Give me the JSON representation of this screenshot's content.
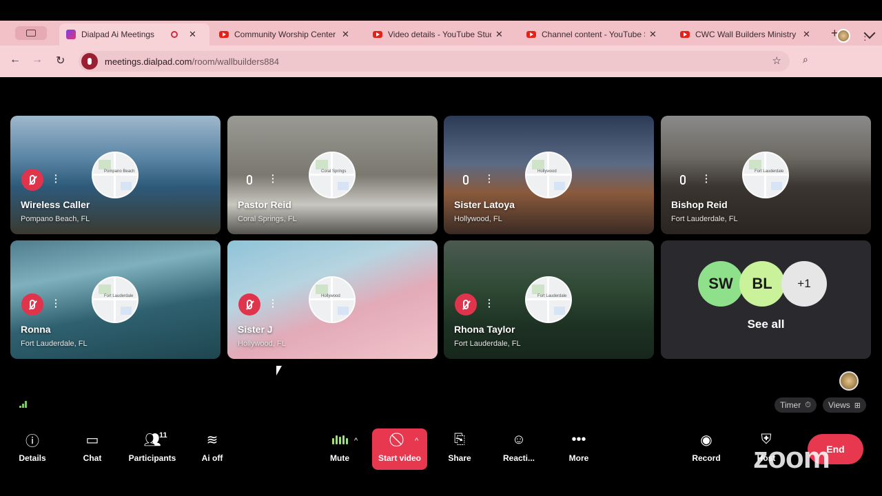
{
  "browser": {
    "tabs": [
      {
        "title": "Dialpad Ai Meetings",
        "kind": "dialpad",
        "active": true
      },
      {
        "title": "Community Worship Center (",
        "kind": "youtube"
      },
      {
        "title": "Video details - YouTube Stud",
        "kind": "youtube"
      },
      {
        "title": "Channel content - YouTube S",
        "kind": "youtube"
      },
      {
        "title": "CWC Wall Builders Ministry (",
        "kind": "youtube"
      }
    ],
    "url_domain": "meetings.dialpad.com",
    "url_path": "/room/wallbuilders884"
  },
  "participants": [
    {
      "name": "Wireless Caller",
      "location": "Pompano Beach, FL",
      "muted": true,
      "map_label": "Pompano Beach"
    },
    {
      "name": "Pastor Reid",
      "location": "Coral Springs, FL",
      "muted": false,
      "map_label": "Coral Springs"
    },
    {
      "name": "Sister Latoya",
      "location": "Hollywood, FL",
      "muted": false,
      "map_label": "Hollywood"
    },
    {
      "name": "Bishop Reid",
      "location": "Fort Lauderdale, FL",
      "muted": false,
      "map_label": "Fort Lauderdale"
    },
    {
      "name": "Ronna",
      "location": "Fort Lauderdale, FL",
      "muted": true,
      "map_label": "Fort Lauderdale"
    },
    {
      "name": "Sister J",
      "location": "Hollywood, FL",
      "muted": true,
      "map_label": "Hollywood"
    },
    {
      "name": "Rhona Taylor",
      "location": "Fort Lauderdale, FL",
      "muted": true,
      "map_label": "Fort Lauderdale"
    }
  ],
  "see_all": {
    "avatars": [
      {
        "initials": "SW",
        "color": "#8fe08a"
      },
      {
        "initials": "BL",
        "color": "#c9f29a"
      },
      {
        "initials": "+1",
        "color": "#e6e6e6"
      }
    ],
    "label": "See all"
  },
  "pills": {
    "timer": "Timer",
    "views": "Views"
  },
  "controls": {
    "details": "Details",
    "chat": "Chat",
    "participants": "Participants",
    "participants_count": "11",
    "ai": "Ai off",
    "mute": "Mute",
    "start_video": "Start video",
    "share": "Share",
    "reactions": "Reacti...",
    "more": "More",
    "record": "Record",
    "host": "Host",
    "end": "End"
  },
  "watermark": "zoom",
  "colors": {
    "accent_red": "#e8384f",
    "muted_red": "#e0344c",
    "tabstrip": "#f2c1c8"
  }
}
